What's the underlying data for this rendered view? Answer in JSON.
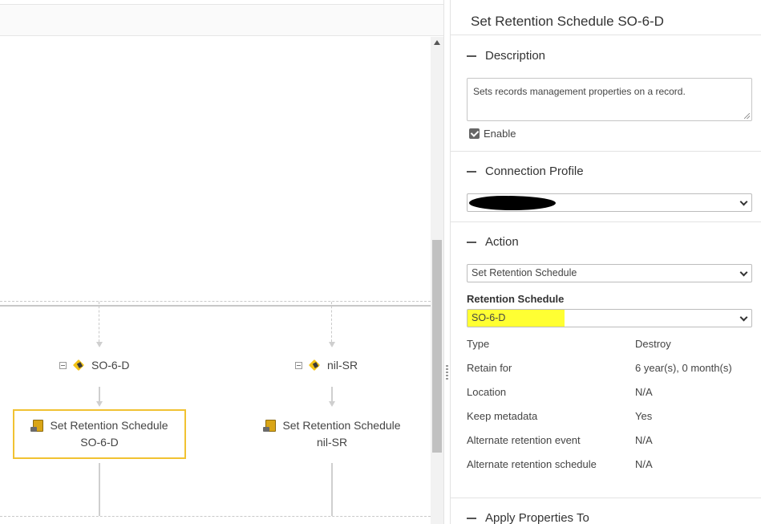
{
  "flow": {
    "branches": [
      {
        "label": "SO-6-D",
        "node_line1": "Set Retention Schedule",
        "node_line2": "SO-6-D",
        "selected": true
      },
      {
        "label": "nil-SR",
        "node_line1": "Set Retention Schedule",
        "node_line2": "nil-SR",
        "selected": false
      }
    ]
  },
  "panel": {
    "title": "Set Retention Schedule SO-6-D",
    "description": {
      "heading": "Description",
      "text": "Sets records management properties on a record.",
      "enable_label": "Enable",
      "enabled": true
    },
    "connection_profile": {
      "heading": "Connection Profile",
      "value_redacted": true
    },
    "action": {
      "heading": "Action",
      "value": "Set Retention Schedule",
      "retention_schedule_label": "Retention Schedule",
      "retention_schedule_value": "SO-6-D",
      "properties": [
        {
          "key": "Type",
          "value": "Destroy"
        },
        {
          "key": "Retain for",
          "value": "6 year(s), 0 month(s)"
        },
        {
          "key": "Location",
          "value": "N/A"
        },
        {
          "key": "Keep metadata",
          "value": "Yes"
        },
        {
          "key": "Alternate retention event",
          "value": "N/A"
        },
        {
          "key": "Alternate retention schedule",
          "value": "N/A"
        }
      ]
    },
    "apply_properties": {
      "heading": "Apply Properties To"
    }
  },
  "colors": {
    "selection_border": "#f1c232",
    "highlight": "#ffff33",
    "tag_icon": "#f3c316"
  }
}
